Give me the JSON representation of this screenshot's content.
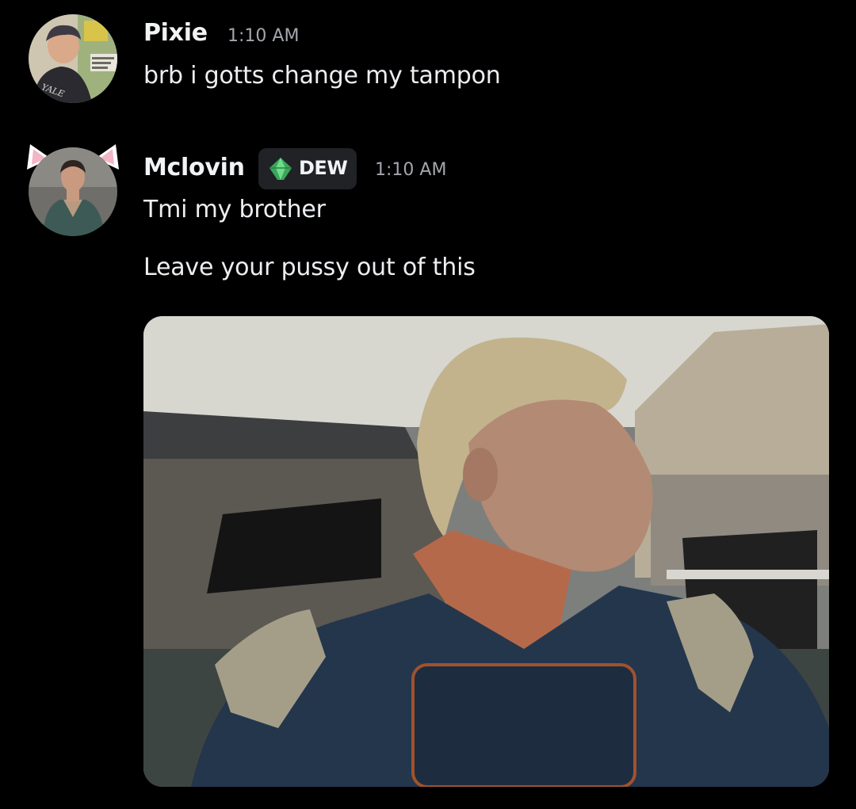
{
  "messages": [
    {
      "author": "Pixie",
      "timestamp": "1:10 AM",
      "lines": [
        "brb i gotts change my tampon"
      ]
    },
    {
      "author": "Mclovin",
      "timestamp": "1:10 AM",
      "role_tag": {
        "label": "DEW",
        "icon": "green-gem-icon",
        "color": "#3ba55c"
      },
      "lines": [
        "Tmi my brother",
        "Leave your pussy out of this"
      ],
      "attachment": {
        "type": "gif",
        "subject": "man-in-blue-superhero-costume"
      }
    }
  ],
  "colors": {
    "background": "#000000",
    "username": "#f2f3f5",
    "timestamp": "#a4a6ad",
    "message_text": "#eceef1",
    "tag_background": "#202226"
  }
}
